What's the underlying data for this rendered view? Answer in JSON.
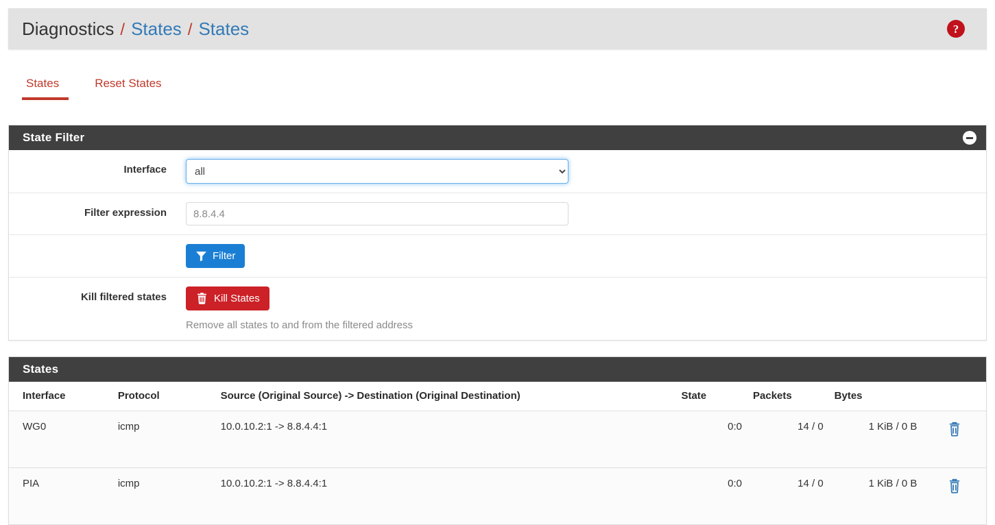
{
  "breadcrumb": {
    "items": [
      {
        "label": "Diagnostics",
        "link": false
      },
      {
        "label": "States",
        "link": true
      },
      {
        "label": "States",
        "link": true
      }
    ],
    "separator": "/",
    "help_icon": "help-circle-icon",
    "help_label": "?"
  },
  "tabs": [
    {
      "label": "States",
      "active": true
    },
    {
      "label": "Reset States",
      "active": false
    }
  ],
  "state_filter": {
    "title": "State Filter",
    "collapse_icon": "minus-circle-icon",
    "interface": {
      "label": "Interface",
      "value": "all",
      "options": [
        "all"
      ]
    },
    "filter_expression": {
      "label": "Filter expression",
      "value": "8.8.4.4",
      "placeholder": ""
    },
    "filter_button": {
      "label": "Filter",
      "icon": "filter-funnel-icon",
      "color": "#1a7fd4"
    },
    "kill_states": {
      "label": "Kill filtered states",
      "button_label": "Kill States",
      "button_icon": "trash-icon",
      "button_color": "#cc2127",
      "help_text": "Remove all states to and from the filtered address"
    }
  },
  "states_panel": {
    "title": "States",
    "columns": [
      "Interface",
      "Protocol",
      "Source (Original Source) -> Destination (Original Destination)",
      "State",
      "Packets",
      "Bytes",
      ""
    ],
    "rows": [
      {
        "interface": "WG0",
        "protocol": "icmp",
        "address": "10.0.10.2:1 -> 8.8.4.4:1",
        "state": "0:0",
        "packets": "14 / 0",
        "bytes": "1 KiB / 0 B",
        "action_icon": "trash-icon"
      },
      {
        "interface": "PIA",
        "protocol": "icmp",
        "address": "10.0.10.2:1 -> 8.8.4.4:1",
        "state": "0:0",
        "packets": "14 / 0",
        "bytes": "1 KiB / 0 B",
        "action_icon": "trash-icon"
      }
    ]
  }
}
